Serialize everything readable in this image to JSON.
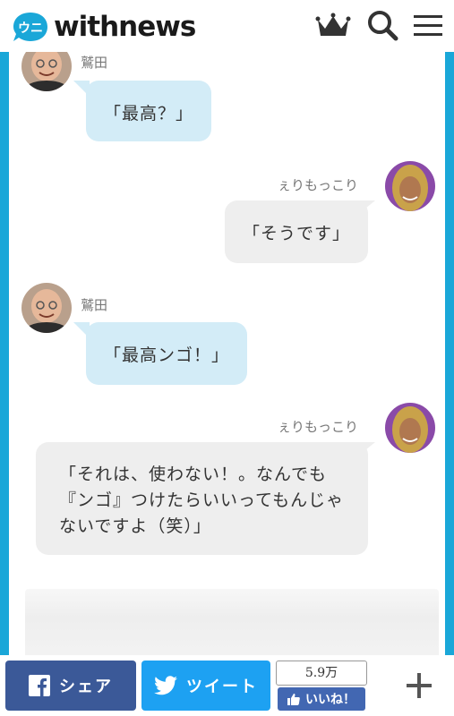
{
  "header": {
    "logo_text": "withnews",
    "logo_mark": "ウニ",
    "icons": [
      "crown-icon",
      "search-icon",
      "menu-icon"
    ],
    "accent_color": "#1aa7d8"
  },
  "chat": {
    "messages": [
      {
        "speaker": "鷲田",
        "text": "「最高？」",
        "side": "left"
      },
      {
        "speaker": "ぇりもっこり",
        "text": "「そうです」",
        "side": "right"
      },
      {
        "speaker": "鷲田",
        "text": "「最高ンゴ！」",
        "side": "left"
      },
      {
        "speaker": "ぇりもっこり",
        "lines": [
          "「それは、使わない！。なんでも",
          "『ンゴ』つけたらいいってもんじゃ",
          "ないですよ（笑）」"
        ],
        "side": "right"
      }
    ]
  },
  "sharebar": {
    "facebook_label": "シェア",
    "twitter_label": "ツイート",
    "like_count": "5.9万",
    "like_label": "いいね！",
    "plus": "+"
  }
}
